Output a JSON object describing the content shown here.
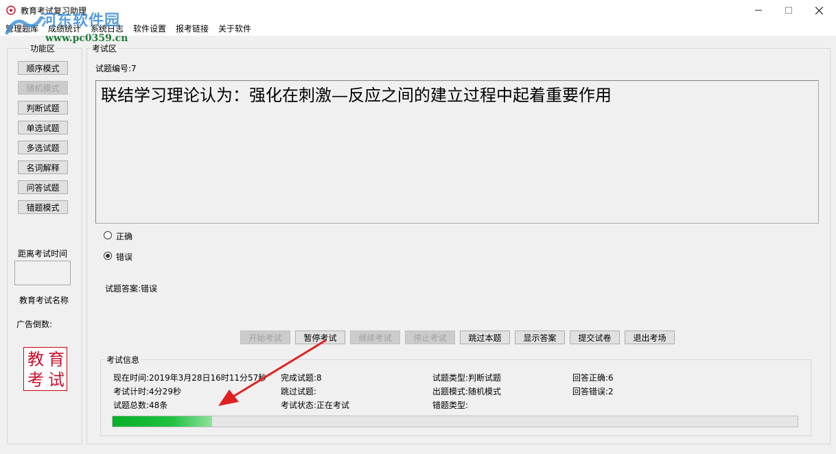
{
  "window": {
    "title": "教育考试复习助理",
    "controls": {
      "minimize": "—",
      "maximize": "☐",
      "close": "✕"
    }
  },
  "watermark": {
    "text": "河东软件园",
    "url": "www.pc0359.cn"
  },
  "menu": [
    "管理题库",
    "成绩统计",
    "系统日志",
    "软件设置",
    "报考链接",
    "关于软件"
  ],
  "sidebar": {
    "title": "功能区",
    "buttons": [
      {
        "label": "顺序模式",
        "enabled": true
      },
      {
        "label": "随机模式",
        "enabled": false
      },
      {
        "label": "判断试题",
        "enabled": true
      },
      {
        "label": "单选试题",
        "enabled": true
      },
      {
        "label": "多选试题",
        "enabled": true
      },
      {
        "label": "名词解释",
        "enabled": true
      },
      {
        "label": "问答试题",
        "enabled": true
      },
      {
        "label": "错题模式",
        "enabled": true
      }
    ],
    "countdown_label": "距离考试时间",
    "exam_name_label": "教育考试名称",
    "ad_label": "广告倒数:",
    "seal_chars": [
      "教",
      "育",
      "考",
      "试"
    ]
  },
  "exam": {
    "title": "考试区",
    "question_number": "试题编号:7",
    "question_text": "联结学习理论认为：强化在刺激—反应之间的建立过程中起着重要作用",
    "options": [
      {
        "label": "正确",
        "selected": false
      },
      {
        "label": "错误",
        "selected": true
      }
    ],
    "answer": "试题答案:错误",
    "actions": [
      {
        "label": "开始考试",
        "enabled": false
      },
      {
        "label": "暂停考试",
        "enabled": true
      },
      {
        "label": "继续考试",
        "enabled": false
      },
      {
        "label": "停止考试",
        "enabled": false
      },
      {
        "label": "跳过本题",
        "enabled": true
      },
      {
        "label": "显示答案",
        "enabled": true
      },
      {
        "label": "提交试卷",
        "enabled": true
      },
      {
        "label": "退出考场",
        "enabled": true
      }
    ]
  },
  "info": {
    "title": "考试信息",
    "current_time": "现在时间:2019年3月28日16时11分57秒",
    "timer": "考试计时:4分29秒",
    "total": "试题总数:48条",
    "completed": "完成试题:8",
    "skipped": "跳过试题:",
    "status": "考试状态:正在考试",
    "question_type": "试题类型:判断试题",
    "mode": "出题模式:随机模式",
    "wrong_type": "错题类型:",
    "correct_count": "回答正确:6",
    "wrong_count": "回答错误:2",
    "progress": 0.145
  },
  "colors": {
    "annotation_arrow": "#e02020",
    "progress": "#06b025"
  }
}
